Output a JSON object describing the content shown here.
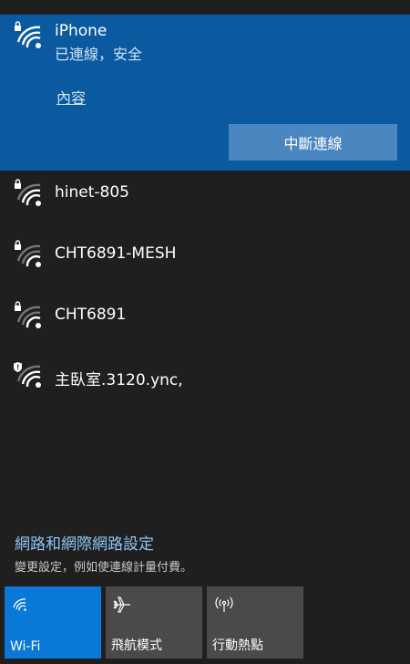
{
  "connected_network": {
    "name": "iPhone",
    "status": "已連線，安全",
    "properties_link": "內容",
    "disconnect_button": "中斷連線"
  },
  "networks": [
    {
      "name": "hinet-805",
      "icon": "wifi-secured-icon"
    },
    {
      "name": "CHT6891-MESH",
      "icon": "wifi-secured-icon"
    },
    {
      "name": "CHT6891",
      "icon": "wifi-secured-icon"
    },
    {
      "name": "主臥室.3120.ync,",
      "icon": "wifi-warning-icon"
    }
  ],
  "settings": {
    "link": "網路和網際網路設定",
    "description": "變更設定，例如使連線計量付費。"
  },
  "quick_actions": [
    {
      "label": "Wi-Fi",
      "icon": "wifi-icon",
      "active": true
    },
    {
      "label": "飛航模式",
      "icon": "airplane-icon",
      "active": false
    },
    {
      "label": "行動熱點",
      "icon": "hotspot-icon",
      "active": false
    }
  ],
  "colors": {
    "panel_background": "#1f1f1f",
    "connected_background": "#0b5aa0",
    "accent": "#0a78d7",
    "link": "#8ec5f5"
  }
}
